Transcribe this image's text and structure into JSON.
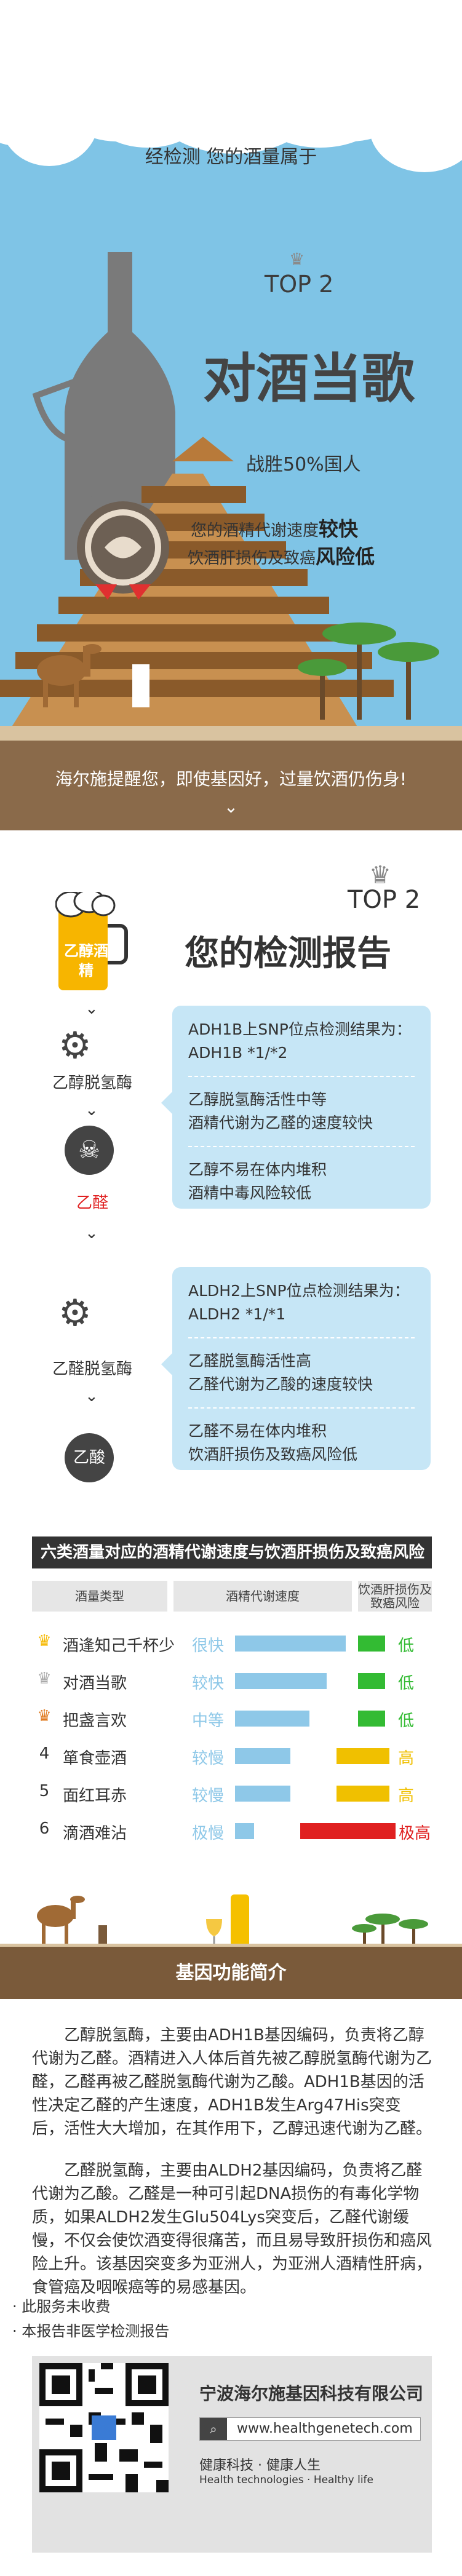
{
  "hero": {
    "intro": "经检测   您的酒量属于",
    "rank": "TOP 2",
    "title": "对酒当歌",
    "beat": "战胜50%国人",
    "desc_line1_prefix": "您的酒精代谢速度",
    "desc_line1_strong": "较快",
    "desc_line2_prefix": "饮酒肝损伤及致癌",
    "desc_line2_strong": "风险低",
    "reminder": "海尔施提醒您，即使基因好，过量饮酒仍伤身!"
  },
  "report": {
    "rank": "TOP 2",
    "title": "您的检测报告",
    "glass_label": "乙醇酒精",
    "enzyme1_label": "乙醇脱氢酶",
    "intermediate_label": "乙醛",
    "enzyme2_label": "乙醛脱氢酶",
    "final_label": "乙酸",
    "box1": {
      "line1": "ADH1B上SNP位点检测结果为：",
      "line2": "ADH1B *1/*2",
      "line3": "乙醇脱氢酶活性中等",
      "line4": "酒精代谢为乙醛的速度较快",
      "line5": "乙醇不易在体内堆积",
      "line6": "酒精中毒风险较低"
    },
    "box2": {
      "line1": "ALDH2上SNP位点检测结果为：",
      "line2": "ALDH2 *1/*1",
      "line3": "乙醛脱氢酶活性高",
      "line4": "乙醛代谢为乙酸的速度较快",
      "line5": "乙醛不易在体内堆积",
      "line6": "饮酒肝损伤及致癌风险低"
    }
  },
  "table": {
    "title": "六类酒量对应的酒精代谢速度与饮酒肝损伤及致癌风险",
    "headers": [
      "酒量类型",
      "酒精代谢速度",
      "饮酒肝损伤及致癌风险"
    ],
    "rows": [
      {
        "icon": "gold-crown-icon",
        "num": "",
        "name": "酒逢知己千杯少",
        "speed": "很快",
        "speed_level": 1.0,
        "risk": "低",
        "risk_color": "#33bb33"
      },
      {
        "icon": "silver-crown-icon",
        "num": "",
        "name": "对酒当歌",
        "speed": "较快",
        "speed_level": 0.83,
        "risk": "低",
        "risk_color": "#33bb33"
      },
      {
        "icon": "bronze-crown-icon",
        "num": "",
        "name": "把盏言欢",
        "speed": "中等",
        "speed_level": 0.67,
        "risk": "低",
        "risk_color": "#33bb33"
      },
      {
        "icon": "",
        "num": "4",
        "name": "箪食壶酒",
        "speed": "较慢",
        "speed_level": 0.5,
        "risk": "高",
        "risk_color": "#f0c000"
      },
      {
        "icon": "",
        "num": "5",
        "name": "面红耳赤",
        "speed": "较慢",
        "speed_level": 0.5,
        "risk": "高",
        "risk_color": "#f0c000"
      },
      {
        "icon": "",
        "num": "6",
        "name": "滴酒难沾",
        "speed": "极慢",
        "speed_level": 0.17,
        "risk": "极高",
        "risk_color": "#e02020"
      }
    ]
  },
  "intro": {
    "title": "基因功能简介",
    "para1": "乙醇脱氢酶，主要由ADH1B基因编码，负责将乙醇代谢为乙醛。酒精进入人体后首先被乙醇脱氢酶代谢为乙醛，乙醛再被乙醛脱氢酶代谢为乙酸。ADH1B基因的活性决定乙醛的产生速度，ADH1B发生Arg47His突变后，活性大大增加，在其作用下，乙醇迅速代谢为乙醛。",
    "para2": "乙醛脱氢酶，主要由ALDH2基因编码，负责将乙醛代谢为乙酸。乙醛是一种可引起DNA损伤的有毒化学物质，如果ALDH2发生Glu504Lys突变后，乙醛代谢缓慢，不仅会使饮酒变得很痛苦，而且易导致肝损伤和癌风险上升。该基因突变多为亚洲人，为亚洲人酒精性肝病，食管癌及咽喉癌等的易感基因。"
  },
  "notes": [
    "· 此服务未收费",
    "· 本报告非医学检测报告"
  ],
  "footer": {
    "company": "宁波海尔施基因科技有限公司",
    "url": "www.healthgenetech.com",
    "slogan": "健康科技 · 健康人生",
    "slogan_en": "Health technologies  ·  Healthy life"
  }
}
